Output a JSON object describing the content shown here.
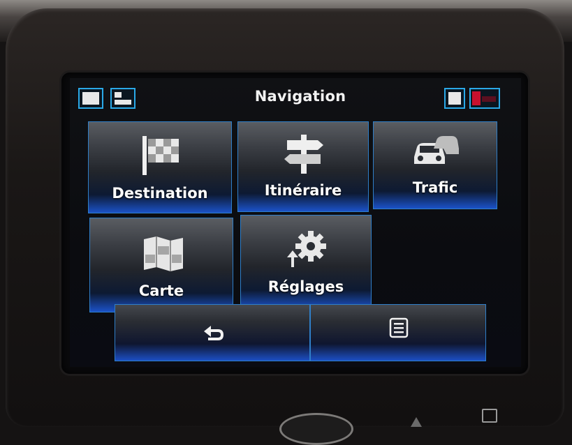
{
  "header": {
    "title": "Navigation",
    "left_icons": [
      "map-view-icon",
      "split-view-icon"
    ],
    "right_icons": [
      "phone-icon",
      "signal-icon"
    ]
  },
  "tiles": [
    {
      "label": "Destination",
      "icon": "flag-icon"
    },
    {
      "label": "Itinéraire",
      "icon": "signpost-icon"
    },
    {
      "label": "Trafic",
      "icon": "traffic-car-icon"
    },
    {
      "label": "Carte",
      "icon": "map-icon"
    },
    {
      "label": "Réglages",
      "icon": "gear-icon"
    }
  ],
  "bottom_bar": {
    "back_icon": "back-arrow-icon",
    "menu_icon": "menu-list-icon"
  },
  "colors": {
    "accent": "#2f7fc9",
    "glow": "#1b52c8",
    "text": "#ffffff",
    "status_red": "#c8102e"
  }
}
